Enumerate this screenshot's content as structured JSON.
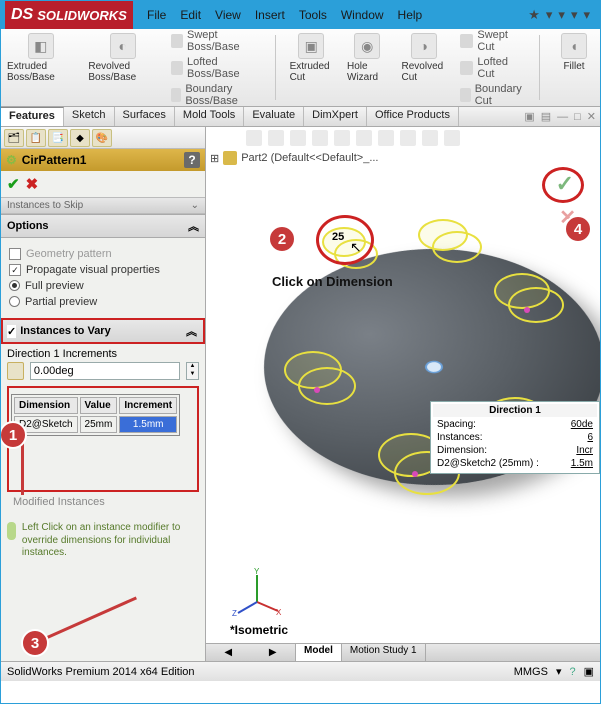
{
  "app": {
    "name": "SOLIDWORKS"
  },
  "menu": [
    "File",
    "Edit",
    "View",
    "Insert",
    "Tools",
    "Window",
    "Help"
  ],
  "ribbon": {
    "extruded_boss": "Extruded Boss/Base",
    "revolved_boss": "Revolved Boss/Base",
    "swept_boss": "Swept Boss/Base",
    "lofted_boss": "Lofted Boss/Base",
    "boundary_boss": "Boundary Boss/Base",
    "extruded_cut": "Extruded Cut",
    "hole_wizard": "Hole Wizard",
    "revolved_cut": "Revolved Cut",
    "swept_cut": "Swept Cut",
    "lofted_cut": "Lofted Cut",
    "boundary_cut": "Boundary Cut",
    "fillet": "Fillet"
  },
  "tabs": [
    "Features",
    "Sketch",
    "Surfaces",
    "Mold Tools",
    "Evaluate",
    "DimXpert",
    "Office Products"
  ],
  "pm": {
    "title": "CirPattern1",
    "options_label": "Options",
    "geom_pattern": "Geometry pattern",
    "propagate": "Propagate visual properties",
    "full_preview": "Full preview",
    "partial_preview": "Partial preview",
    "instances_to_vary": "Instances to Vary",
    "dir1_label": "Direction 1 Increments",
    "angle_value": "0.00deg",
    "col_dimension": "Dimension",
    "col_value": "Value",
    "col_increment": "Increment",
    "row_dim": "D2@Sketch",
    "row_val": "25mm",
    "row_inc": "1.5mm",
    "modified_label": "Modified Instances",
    "tip": "Left Click on an instance modifier to override dimensions for individual instances."
  },
  "viewport": {
    "part_name": "Part2  (Default<<Default>_...",
    "click_label": "Click on Dimension",
    "dim_text": "25",
    "dir_panel_title": "Direction 1",
    "spacing_label": "Spacing:",
    "spacing_value": "60de",
    "instances_label": "Instances:",
    "instances_value": "6",
    "dimension_label": "Dimension:",
    "dimension_value": "Incr",
    "d2_label": "D2@Sketch2 (25mm) :",
    "d2_value": "1.5m",
    "iso": "*Isometric"
  },
  "bottom_tabs": [
    "Model",
    "Motion Study 1"
  ],
  "status": {
    "text": "SolidWorks Premium 2014 x64 Edition",
    "units": "MMGS"
  },
  "annotations": {
    "n1": "1",
    "n2": "2",
    "n3": "3",
    "n4": "4"
  }
}
